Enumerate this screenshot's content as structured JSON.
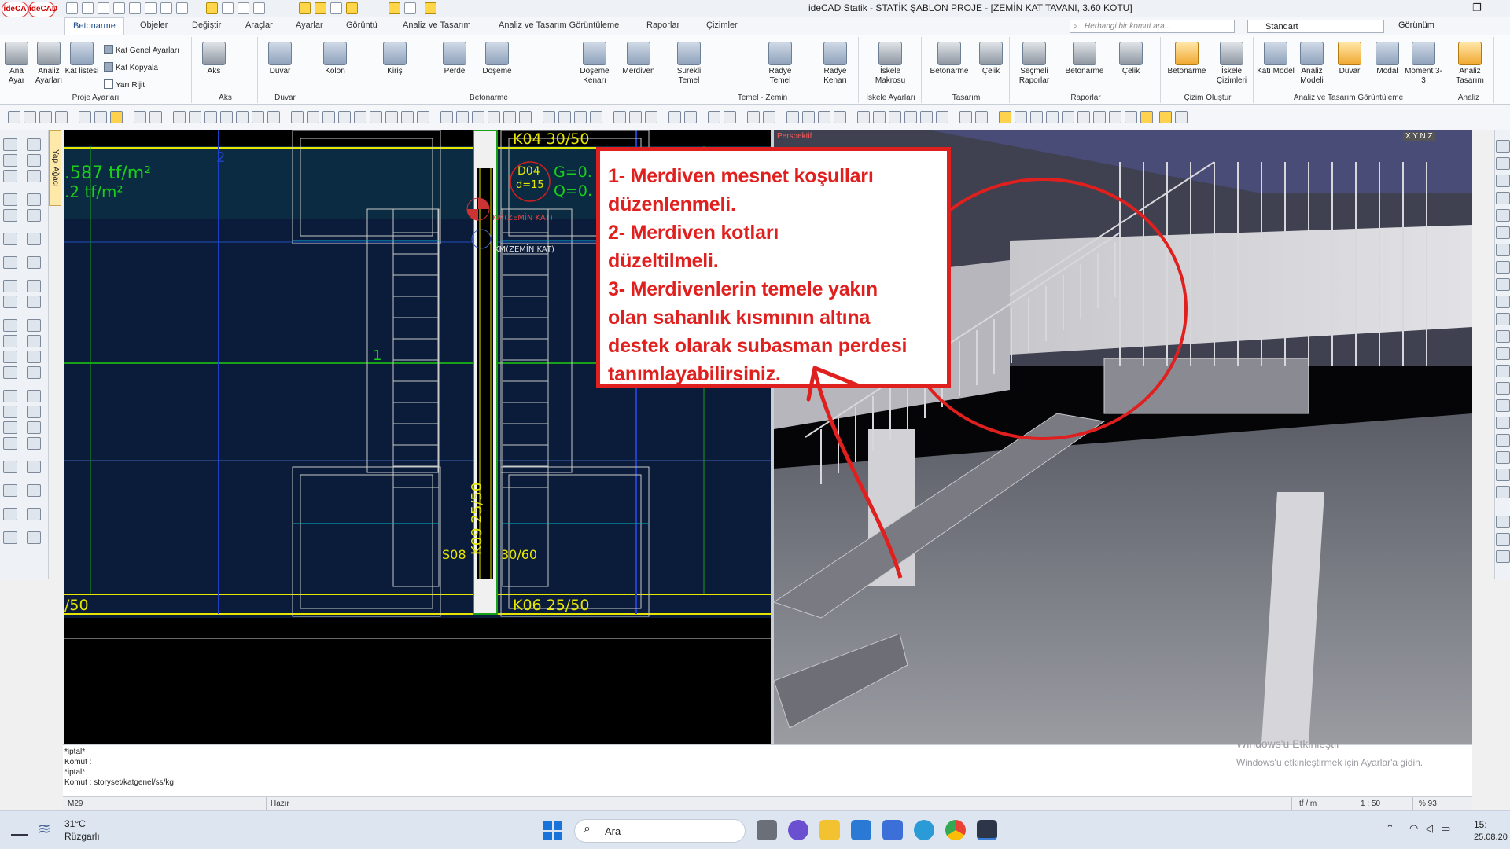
{
  "titlebar": {
    "logo1": "ideCA",
    "logo2": "ideCAD",
    "title": "ideCAD Statik - STATİK ŞABLON PROJE - [ZEMİN KAT TAVANI,  3.60 KOTU]"
  },
  "tabs": [
    "Betonarme",
    "Objeler",
    "Değiştir",
    "Araçlar",
    "Ayarlar",
    "Görüntü",
    "Analiz ve Tasarım",
    "Analiz ve Tasarım Görüntüleme",
    "Raporlar",
    "Çizimler"
  ],
  "search": {
    "placeholder": "Herhangi bir komut ara..."
  },
  "style_select": "Standart",
  "view_label": "Görünüm",
  "ribbon": {
    "proje": {
      "label": "Proje Ayarları",
      "b1": "Ana Ayar",
      "b2": "Analiz Ayarları",
      "b3": "Kat listesi",
      "s1": "Kat Genel Ayarları",
      "s2": "Kat Kopyala",
      "s3": "Yarı Rijit"
    },
    "aks": {
      "label": "Aks",
      "b1": "Aks"
    },
    "duvar": {
      "label": "Duvar",
      "b1": "Duvar"
    },
    "betonarme": {
      "label": "Betonarme",
      "b1": "Kolon",
      "b2": "Kiriş",
      "b3": "Perde",
      "b4": "Döşeme",
      "b5": "Döşeme Kenarı",
      "b6": "Merdiven"
    },
    "temel": {
      "label": "Temel - Zemin",
      "b1": "Sürekli Temel",
      "b2": "Radye Temel",
      "b3": "Radye Kenarı"
    },
    "iskele": {
      "label": "İskele Ayarları",
      "b1": "İskele Makrosu"
    },
    "tasarim": {
      "label": "Tasarım",
      "b1": "Betonarme",
      "b2": "Çelik"
    },
    "raporlar": {
      "label": "Raporlar",
      "b1": "Seçmeli Raporlar",
      "b2": "Betonarme",
      "b3": "Çelik"
    },
    "cizim": {
      "label": "Çizim Oluştur",
      "b1": "Betonarme",
      "b2": "İskele Çizimleri"
    },
    "analizgor": {
      "label": "Analiz ve Tasarım Görüntüleme",
      "b1": "Katı Model",
      "b2": "Analiz Modeli",
      "b3": "Duvar",
      "b4": "Modal",
      "b5": "Moment 3-3"
    },
    "analiz": {
      "label": "Analiz",
      "b1": "Analiz Tasarım"
    }
  },
  "side_tab": "Yapı Ağacı",
  "cad": {
    "load1": ".587 tf/m²",
    "load2": ".2 tf/m²",
    "axis2": "2",
    "axis1": "1",
    "beam_top": "K04 30/50",
    "beam_bottom": "K06 25/50",
    "beam_left": "/50",
    "beam_vertical": "K09 25/50",
    "slab_id": "D04",
    "slab_d": "d=15",
    "slab_g": "G=0.",
    "slab_q": "Q=0.",
    "level1": "KM(ZEMİN KAT)",
    "level2": "KM(ZEMİN KAT)",
    "col_label": "S08",
    "col_size": "30/60"
  },
  "view3d": {
    "label": "Perspektif",
    "axes": "X Y N Z"
  },
  "annotation": [
    "1- Merdiven mesnet koşulları",
    "düzenlenmeli.",
    "2- Merdiven kotları",
    "düzeltilmeli.",
    "3- Merdivenlerin temele yakın",
    "olan sahanlık kısmının altına",
    "destek olarak subasman perdesi",
    "tanımlayabilirsiniz."
  ],
  "command_lines": [
    "*iptal*",
    "Komut :",
    "*iptal*",
    "Komut : storyset/katgenel/ss/kg"
  ],
  "status": {
    "s1": "M29",
    "s2": "Hazır",
    "s3": "tf / m",
    "s4": "1 : 50",
    "s5": "% 93"
  },
  "watermark": {
    "line1": "Windows'u Etkinleştir",
    "line2": "Windows'u etkinleştirmek için Ayarlar'a gidin."
  },
  "taskbar": {
    "temp": "31°C",
    "weather": "Rüzgarlı",
    "search": "Ara",
    "time": "15:",
    "date": "25.08.20"
  },
  "colors": {
    "annotation_red": "#e0201e",
    "cad_yellow": "#e6e600",
    "cad_cyan": "#00c8c8",
    "cad_green": "#19a019"
  }
}
